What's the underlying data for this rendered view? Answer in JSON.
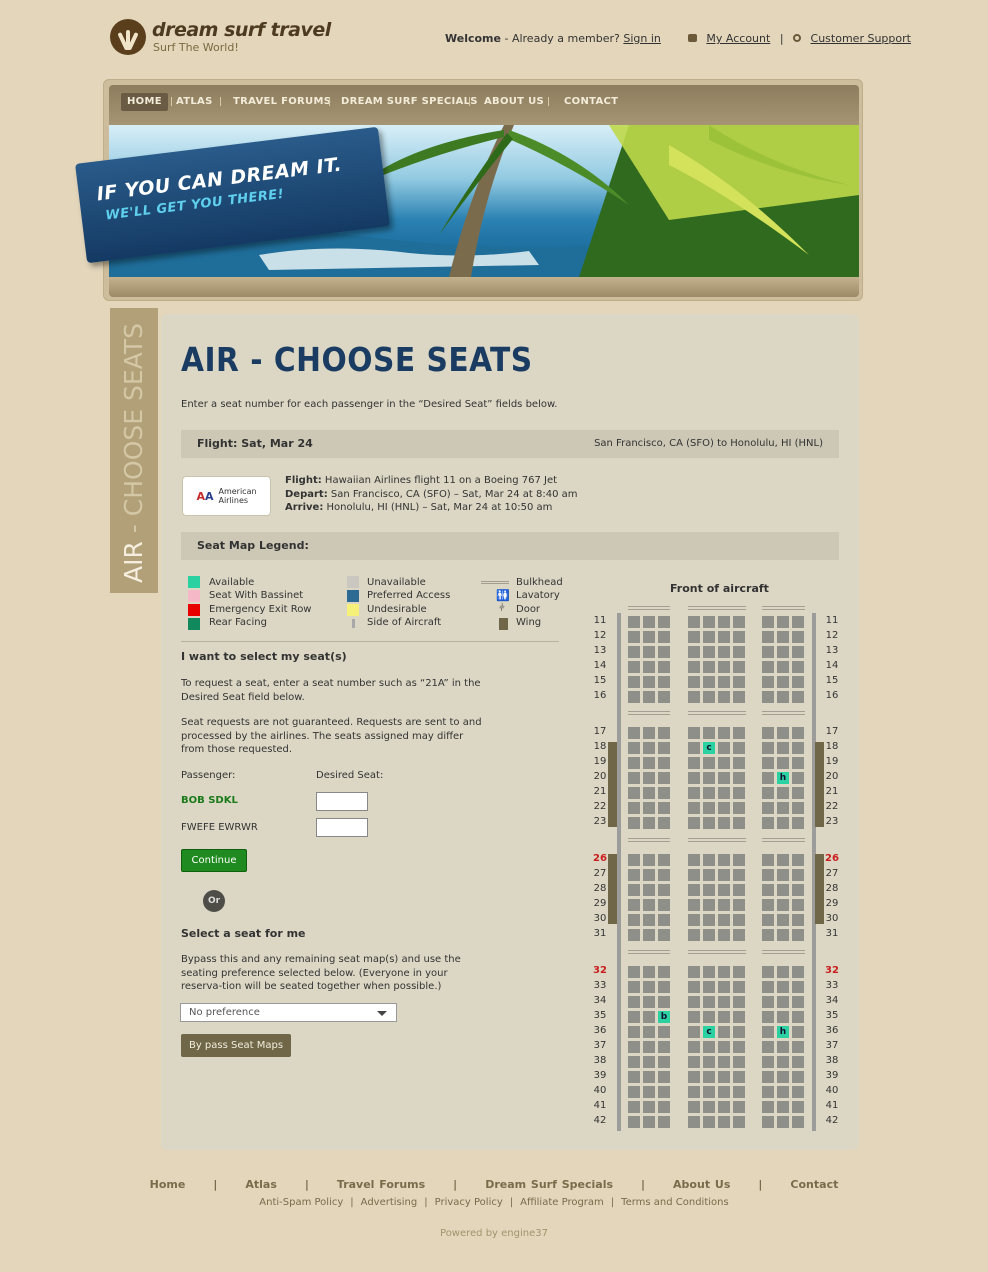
{
  "brand": {
    "name": "dream surf travel",
    "tagline": "Surf The World!"
  },
  "topnav": {
    "welcome": "Welcome",
    "member_text": "- Already a member?",
    "sign_in": "Sign in",
    "my_account": "My Account",
    "sep": "|",
    "support": "Customer Support"
  },
  "menu": [
    "HOME",
    "ATLAS",
    "TRAVEL FORUMS",
    "DREAM SURF SPECIALS",
    "ABOUT US",
    "CONTACT"
  ],
  "banner": {
    "line1": "IF YOU CAN DREAM IT.",
    "line2": "WE'LL GET YOU THERE!"
  },
  "sidetab": {
    "part1": "AIR",
    "dash": " - ",
    "part2": "CHOOSE SEATS"
  },
  "page": {
    "title": "AIR - CHOOSE SEATS",
    "intro": "Enter a seat number for each passenger in the “Desired Seat” fields below."
  },
  "flight": {
    "bar_label": "Flight: Sat, Mar 24",
    "route": "San Francisco, CA (SFO) to Honolulu, HI (HNL)",
    "airline_name_1": "American",
    "airline_name_2": "Airlines",
    "flight_label": "Flight:",
    "flight_value": " Hawaiian Airlines flight 11 on a Boeing 767 Jet",
    "depart_label": "Depart:",
    "depart_value": " San Francisco, CA (SFO) – Sat, Mar 24 at 8:40 am",
    "arrive_label": "Arrive:",
    "arrive_value": " Honolulu, HI (HNL) – Sat, Mar 24 at 10:50 am"
  },
  "legend": {
    "title": "Seat Map Legend:",
    "col1": [
      "Available",
      "Seat With Bassinet",
      "Emergency Exit Row",
      "Rear Facing"
    ],
    "col2": [
      "Unavailable",
      "Preferred Access",
      "Undesirable",
      "Side of Aircraft"
    ],
    "col3": [
      "Bulkhead",
      "Lavatory",
      "Door",
      "Wing"
    ],
    "colors": {
      "available": "#2bd1a1",
      "bassinet": "#f4b8c6",
      "exit": "#e80000",
      "rear": "#108a5c",
      "unavailable": "#c9c7c0",
      "preferred": "#2c6a94",
      "undesirable": "#f5f07a",
      "side": "#a8a8a8"
    }
  },
  "select_seat": {
    "heading": "I want to select my seat(s)",
    "p1": "To request a seat, enter a seat number such as “21A” in the Desired Seat field below.",
    "p2": "Seat requests are not guaranteed. Requests are sent to and processed by the airlines. The seats assigned may differ from those requested.",
    "passenger_label": "Passenger:",
    "desired_label": "Desired Seat:",
    "passengers": [
      "BOB SDKL",
      "FWEFE EWRWR"
    ],
    "continue": "Continue"
  },
  "or": "Or",
  "auto_seat": {
    "heading": "Select a seat for me",
    "p1": "Bypass this and any remaining seat map(s) and use the seating preference selected below. (Everyone in your reserva-tion will be seated together when possible.)",
    "preference": "No preference",
    "bypass": "By pass Seat Maps"
  },
  "seatmap": {
    "front_label": "Front of aircraft",
    "rows": [
      11,
      12,
      13,
      14,
      15,
      16,
      17,
      18,
      19,
      20,
      21,
      22,
      23,
      26,
      27,
      28,
      29,
      30,
      31,
      32,
      33,
      34,
      35,
      36,
      37,
      38,
      39,
      40,
      41,
      42
    ],
    "highlight_rows": [
      26,
      32
    ],
    "available": [
      {
        "row": 18,
        "col": 4,
        "label": "c"
      },
      {
        "row": 20,
        "col": 8,
        "label": "h"
      },
      {
        "row": 35,
        "col": 2,
        "label": "b"
      },
      {
        "row": 36,
        "col": 4,
        "label": "c"
      },
      {
        "row": 36,
        "col": 8,
        "label": "h"
      }
    ]
  },
  "footer": {
    "links": [
      "Home",
      "Atlas",
      "Travel Forums",
      "Dream Surf Specials",
      "About Us",
      "Contact"
    ],
    "sep": "|",
    "sublinks": [
      "Anti-Spam Policy",
      "Advertising",
      "Privacy Policy",
      "Affiliate Program",
      "Terms and Conditions"
    ],
    "powered": "Powered by engine37"
  }
}
